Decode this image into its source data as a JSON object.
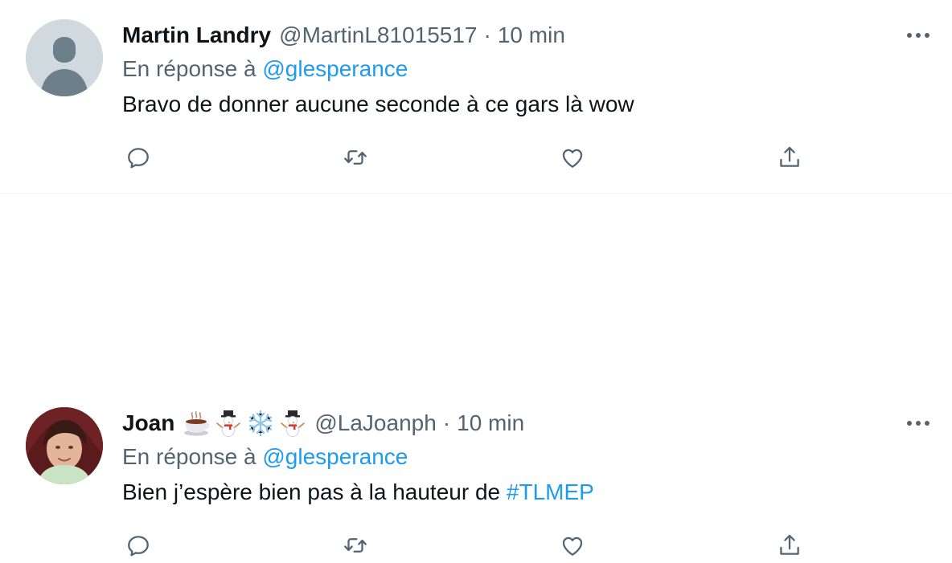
{
  "colors": {
    "text": "#0f1419",
    "secondary": "#536471",
    "link": "#1d9bf0",
    "divider": "#eff3f4"
  },
  "tweets": [
    {
      "name": "Martin Landry",
      "emojis": "",
      "handle": "@MartinL81015517",
      "separator": "·",
      "time": "10 min",
      "reply_prefix": "En réponse à",
      "reply_to": "@glesperance",
      "text": "Bravo de donner aucune seconde à ce gars là wow",
      "hashtag": "",
      "actions": [
        "reply-icon",
        "retweet-icon",
        "like-icon",
        "share-icon"
      ]
    },
    {
      "name": "Joan",
      "emojis": "☕ ⛄ ❄️ ⛄",
      "handle": "@LaJoanph",
      "separator": "·",
      "time": "10 min",
      "reply_prefix": "En réponse à",
      "reply_to": "@glesperance",
      "text": "Bien j’espère bien pas à la hauteur de",
      "hashtag": "#TLMEP",
      "actions": [
        "reply-icon",
        "retweet-icon",
        "like-icon",
        "share-icon"
      ]
    }
  ]
}
